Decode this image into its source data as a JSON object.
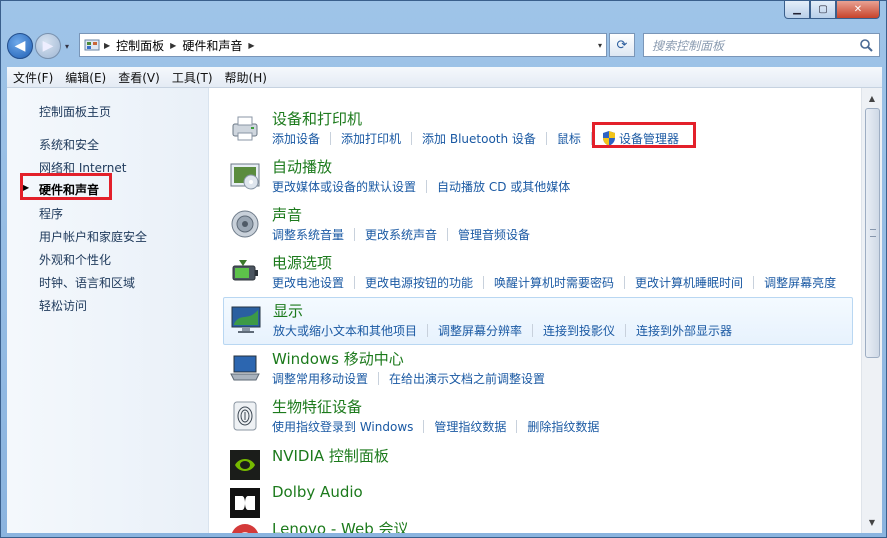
{
  "window": {
    "controls": {
      "minimize": "▁",
      "maximize": "▢",
      "close": "✕"
    }
  },
  "nav": {
    "back_glyph": "◀",
    "forward_glyph": "▶",
    "dropdown_glyph": "▾",
    "breadcrumb": [
      "控制面板",
      "硬件和声音"
    ],
    "search_placeholder": "搜索控制面板"
  },
  "menu": [
    "文件(F)",
    "编辑(E)",
    "查看(V)",
    "工具(T)",
    "帮助(H)"
  ],
  "sidebar": {
    "items": [
      {
        "label": "控制面板主页"
      },
      {
        "label": "系统和安全"
      },
      {
        "label": "网络和 Internet"
      },
      {
        "label": "硬件和声音",
        "active": true
      },
      {
        "label": "程序"
      },
      {
        "label": "用户帐户和家庭安全"
      },
      {
        "label": "外观和个性化"
      },
      {
        "label": "时钟、语言和区域"
      },
      {
        "label": "轻松访问"
      }
    ]
  },
  "categories": [
    {
      "title": "设备和打印机",
      "icon": "printer-icon",
      "links": [
        "添加设备",
        "添加打印机",
        "添加 Bluetooth 设备",
        "鼠标",
        "设备管理器"
      ]
    },
    {
      "title": "自动播放",
      "icon": "autoplay-icon",
      "links": [
        "更改媒体或设备的默认设置",
        "自动播放 CD 或其他媒体"
      ]
    },
    {
      "title": "声音",
      "icon": "speaker-icon",
      "links": [
        "调整系统音量",
        "更改系统声音",
        "管理音频设备"
      ]
    },
    {
      "title": "电源选项",
      "icon": "battery-icon",
      "links": [
        "更改电池设置",
        "更改电源按钮的功能",
        "唤醒计算机时需要密码",
        "更改计算机睡眠时间",
        "调整屏幕亮度"
      ]
    },
    {
      "title": "显示",
      "icon": "monitor-icon",
      "links": [
        "放大或缩小文本和其他项目",
        "调整屏幕分辨率",
        "连接到投影仪",
        "连接到外部显示器"
      ]
    },
    {
      "title": "Windows 移动中心",
      "icon": "laptop-icon",
      "links": [
        "调整常用移动设置",
        "在给出演示文档之前调整设置"
      ]
    },
    {
      "title": "生物特征设备",
      "icon": "fingerprint-icon",
      "links": [
        "使用指纹登录到 Windows",
        "管理指纹数据",
        "删除指纹数据"
      ]
    },
    {
      "title": "NVIDIA 控制面板",
      "icon": "nvidia-icon",
      "links": []
    },
    {
      "title": "Dolby Audio",
      "icon": "dolby-icon",
      "links": []
    },
    {
      "title": "Lenovo - Web 会议",
      "icon": "lenovo-icon",
      "links": []
    }
  ],
  "scrollbar": {
    "up": "▲",
    "down": "▼"
  }
}
